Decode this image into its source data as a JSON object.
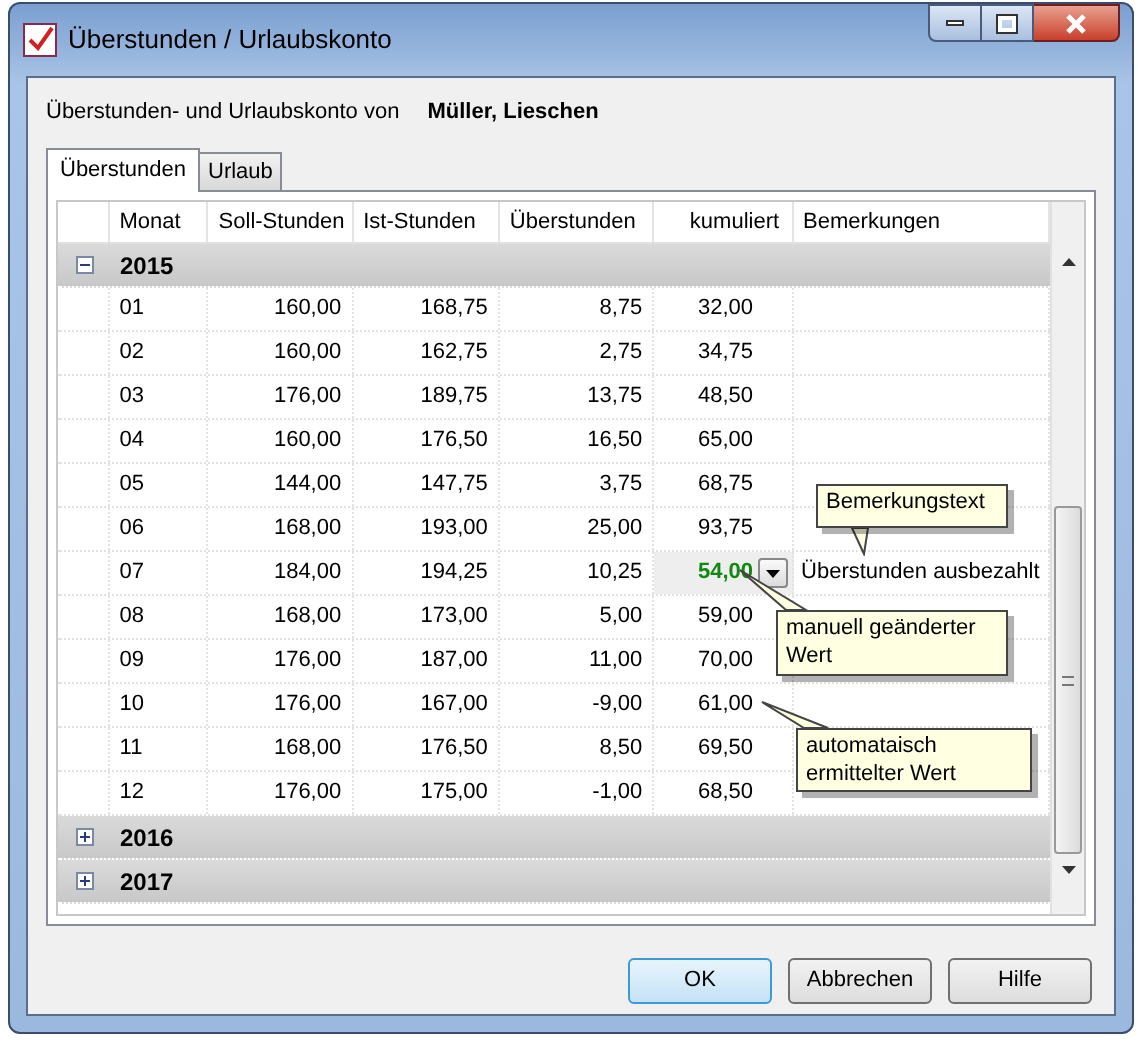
{
  "window": {
    "title": "Überstunden / Urlaubskonto"
  },
  "header": {
    "label": "Überstunden- und Urlaubskonto von",
    "name": "Müller, Lieschen"
  },
  "tabs": [
    {
      "label": "Überstunden",
      "selected": true
    },
    {
      "label": "Urlaub",
      "selected": false
    }
  ],
  "table": {
    "columns": [
      "Monat",
      "Soll-Stunden",
      "Ist-Stunden",
      "Überstunden",
      "kumuliert",
      "Bemerkungen"
    ],
    "groups": [
      {
        "year": "2015",
        "expanded": true,
        "rows": [
          {
            "cells": [
              "01",
              "160,00",
              "168,75",
              "8,75",
              "32,00",
              ""
            ],
            "edited": false
          },
          {
            "cells": [
              "02",
              "160,00",
              "162,75",
              "2,75",
              "34,75",
              ""
            ],
            "edited": false
          },
          {
            "cells": [
              "03",
              "176,00",
              "189,75",
              "13,75",
              "48,50",
              ""
            ],
            "edited": false
          },
          {
            "cells": [
              "04",
              "160,00",
              "176,50",
              "16,50",
              "65,00",
              ""
            ],
            "edited": false
          },
          {
            "cells": [
              "05",
              "144,00",
              "147,75",
              "3,75",
              "68,75",
              ""
            ],
            "edited": false
          },
          {
            "cells": [
              "06",
              "168,00",
              "193,00",
              "25,00",
              "93,75",
              ""
            ],
            "edited": false
          },
          {
            "cells": [
              "07",
              "184,00",
              "194,25",
              "10,25",
              "54,00",
              "Überstunden ausbezahlt"
            ],
            "edited": true
          },
          {
            "cells": [
              "08",
              "168,00",
              "173,00",
              "5,00",
              "59,00",
              ""
            ],
            "edited": false
          },
          {
            "cells": [
              "09",
              "176,00",
              "187,00",
              "11,00",
              "70,00",
              ""
            ],
            "edited": false
          },
          {
            "cells": [
              "10",
              "176,00",
              "167,00",
              "-9,00",
              "61,00",
              ""
            ],
            "edited": false
          },
          {
            "cells": [
              "11",
              "168,00",
              "176,50",
              "8,50",
              "69,50",
              ""
            ],
            "edited": false
          },
          {
            "cells": [
              "12",
              "176,00",
              "175,00",
              "-1,00",
              "68,50",
              ""
            ],
            "edited": false
          }
        ]
      },
      {
        "year": "2016",
        "expanded": false
      },
      {
        "year": "2017",
        "expanded": false
      }
    ]
  },
  "callouts": [
    {
      "text": "Bemerkungstext"
    },
    {
      "text": "manuell geänderter Wert"
    },
    {
      "text": "automataisch ermittelter Wert"
    }
  ],
  "buttons": [
    {
      "label": "OK",
      "default": true
    },
    {
      "label": "Abbrechen",
      "default": false
    },
    {
      "label": "Hilfe",
      "default": false
    }
  ]
}
